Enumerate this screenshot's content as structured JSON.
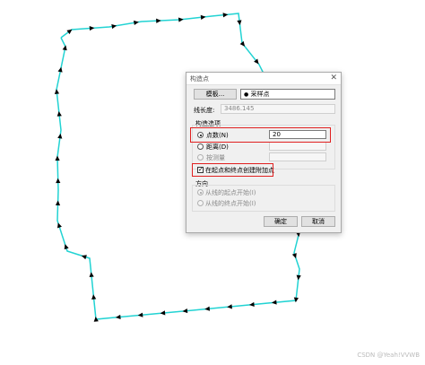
{
  "dialog": {
    "title": "构造点",
    "close_glyph": "✕",
    "template_button": "模板...",
    "feature_icon": "●",
    "feature_name": "采样点",
    "line_length_label": "线长度:",
    "line_length_value": "3486.145",
    "options_group_label": "构造选项",
    "option_count_label": "点数(N)",
    "option_count_value": "20",
    "option_distance_label": "距离(D)",
    "option_measure_label": "按测量",
    "extra_points_label": "在起点和终点创建附加点",
    "extra_points_mark": "✓",
    "direction_group_label": "方向",
    "direction_start_label": "从线的起点开始(I)",
    "direction_end_label": "从线的终点开始(I)",
    "ok_button": "确定",
    "cancel_button": "取消"
  },
  "watermark": "CSDN @Yeah!VVWB",
  "colors": {
    "polyline": "#22d3d3",
    "arrow": "#000000",
    "highlight": "#e02020"
  }
}
